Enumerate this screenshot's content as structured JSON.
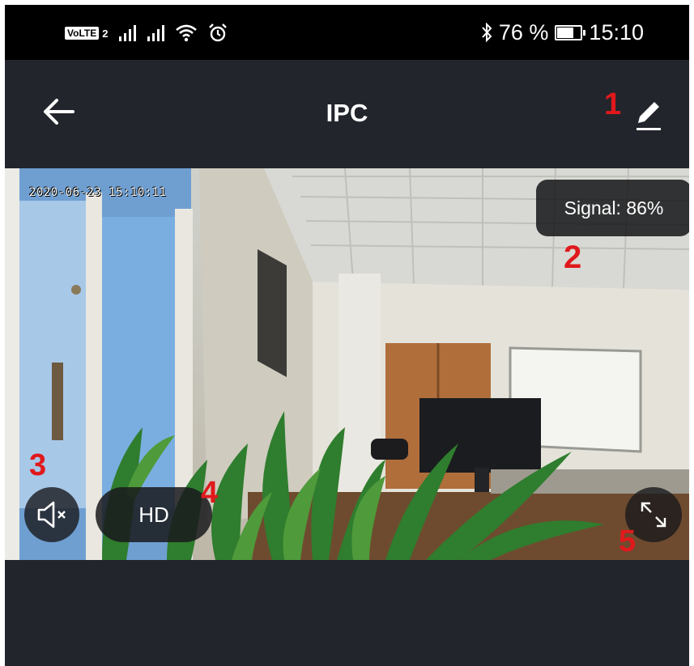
{
  "status_bar": {
    "network_badge": "VoLTE",
    "network_sub": "2",
    "battery_percent": "76 %",
    "battery_level": 0.76,
    "time": "15:10",
    "icons": [
      "volte-icon",
      "signal-bars-icon",
      "signal-bars-icon",
      "wifi-icon",
      "alarm-icon",
      "bluetooth-icon",
      "battery-icon"
    ]
  },
  "app_bar": {
    "title": "IPC",
    "back_icon": "back-arrow-icon",
    "edit_icon": "pencil-icon"
  },
  "video": {
    "timestamp": "2020-06-23 15:10:11",
    "signal_label": "Signal: 86%",
    "quality_label": "HD",
    "mute_icon": "speaker-muted-icon",
    "fullscreen_icon": "fullscreen-icon"
  },
  "annotations": [
    "1",
    "2",
    "3",
    "4",
    "5"
  ],
  "colors": {
    "background": "#23252c",
    "annotation": "#e0191c",
    "status_bar": "#000000"
  }
}
